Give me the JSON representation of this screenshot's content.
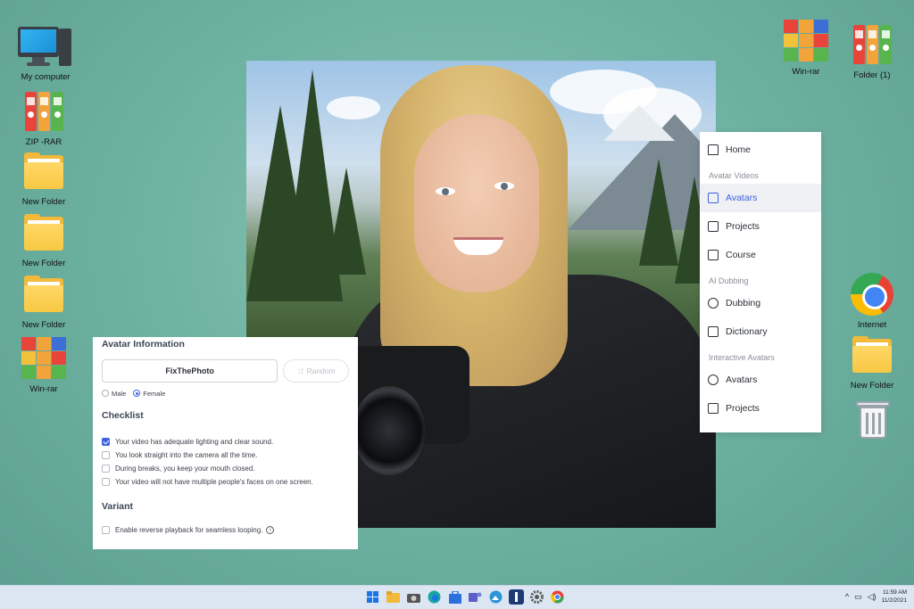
{
  "desktop": {
    "left_icons": [
      {
        "label": "My computer"
      },
      {
        "label": "ZIP -RAR"
      },
      {
        "label": "New Folder"
      },
      {
        "label": "New Folder"
      },
      {
        "label": "New Folder"
      },
      {
        "label": "Win-rar"
      }
    ],
    "right_icons": [
      {
        "label": "Win-rar"
      },
      {
        "label": "Folder (1)"
      },
      {
        "label": "Internet"
      },
      {
        "label": "New Folder"
      },
      {
        "label": "Recycle Bin"
      }
    ]
  },
  "nav": {
    "items": [
      {
        "label": "Home",
        "icon": "home-icon"
      },
      {
        "section": "Avatar Videos"
      },
      {
        "label": "Avatars",
        "icon": "avatar-icon",
        "active": true
      },
      {
        "label": "Projects",
        "icon": "play-icon"
      },
      {
        "label": "Course",
        "icon": "book-icon"
      },
      {
        "section": "AI Dubbing"
      },
      {
        "label": "Dubbing",
        "icon": "dubbing-icon"
      },
      {
        "label": "Dictionary",
        "icon": "dictionary-icon"
      },
      {
        "section": "Interactive Avatars"
      },
      {
        "label": "Avatars",
        "icon": "avatar-icon"
      },
      {
        "label": "Projects",
        "icon": "chat-icon"
      }
    ],
    "accent_color": "#3d63e0"
  },
  "avatar_info": {
    "title": "Avatar Information",
    "name_value": "FixThePhoto",
    "random_label": "Random",
    "gender_options": [
      "Male",
      "Female"
    ],
    "gender_selected": "Female",
    "checklist_title": "Checklist",
    "checklist": [
      {
        "label": "Your video has adequate lighting and clear sound.",
        "checked": true
      },
      {
        "label": "You look straight into the camera all the time.",
        "checked": false
      },
      {
        "label": "During breaks, you keep your mouth closed.",
        "checked": false
      },
      {
        "label": "Your video will not have multiple people's faces on one screen.",
        "checked": false
      }
    ],
    "variant_title": "Variant",
    "variant_option": "Enable reverse playback for seamless looping.",
    "variant_checked": false
  },
  "taskbar": {
    "apps": [
      "windows-start-icon",
      "file-explorer-icon",
      "camera-icon",
      "edge-icon",
      "store-icon",
      "teams-icon",
      "photos-icon",
      "app-icon",
      "settings-icon",
      "chrome-icon"
    ],
    "time": "11:59 AM",
    "date": "11/2/2021"
  }
}
